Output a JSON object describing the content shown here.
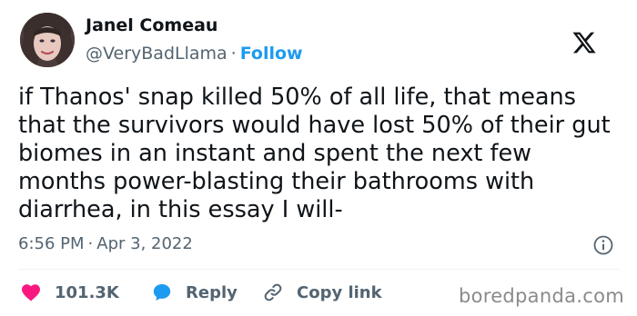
{
  "author": {
    "name": "Janel Comeau",
    "handle": "@VeryBadLlama",
    "separator": "·",
    "follow_label": "Follow"
  },
  "tweet": {
    "text": "if Thanos' snap killed 50% of all life, that means\nthat the survivors would have lost 50% of their gut\nbiomes in an instant and spent the next few\nmonths power-blasting their bathrooms with\ndiarrhea, in this essay I will-",
    "time": "6:56 PM",
    "separator": "·",
    "date": "Apr 3, 2022"
  },
  "actions": {
    "likes": "101.3K",
    "reply_label": "Reply",
    "copy_link_label": "Copy link"
  },
  "watermark": "boredpanda.com",
  "icons": {
    "platform": "x-logo-icon",
    "info": "info-icon",
    "like": "heart-icon",
    "reply": "speech-bubble-icon",
    "copy": "link-icon"
  },
  "colors": {
    "accent": "#1d9bf0",
    "like": "#f91880",
    "text": "#0f1419",
    "muted": "#536471"
  }
}
